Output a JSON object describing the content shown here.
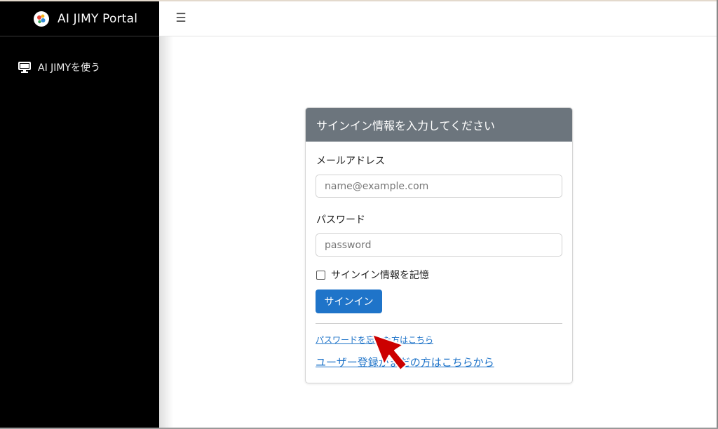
{
  "app": {
    "title": "AI JIMY Portal",
    "logo_icon": "ai-jimy-logo-icon"
  },
  "sidebar": {
    "items": [
      {
        "label": "AI JIMYを使う",
        "icon": "monitor-icon"
      }
    ]
  },
  "topbar": {
    "menu_icon": "hamburger-icon",
    "menu_glyph": "☰"
  },
  "signin_card": {
    "header": "サインイン情報を入力してください",
    "email_label": "メールアドレス",
    "email_placeholder": "name@example.com",
    "email_value": "",
    "password_label": "パスワード",
    "password_placeholder": "password",
    "password_value": "",
    "remember_label": "サインイン情報を記憶",
    "remember_checked": false,
    "submit_label": "サインイン",
    "forgot_link": "パスワードを忘れた方はこちら",
    "register_link": "ユーザー登録がまだの方はこちらから"
  },
  "colors": {
    "sidebar_bg": "#000000",
    "card_header_bg": "#6c757d",
    "primary": "#1f74c9",
    "cursor": "#cc0000"
  }
}
